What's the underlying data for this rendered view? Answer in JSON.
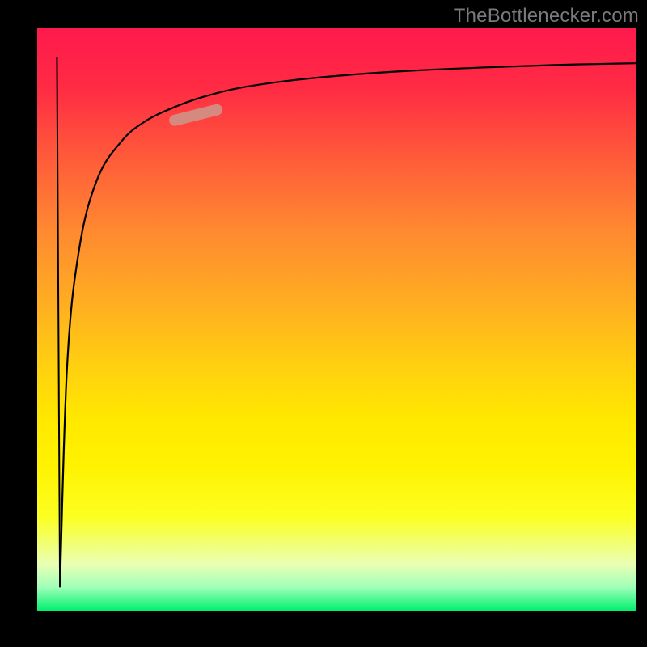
{
  "watermark": "TheBottlenecker.com",
  "chart_data": {
    "type": "line",
    "title": "",
    "xlabel": "",
    "ylabel": "",
    "xlim": [
      0,
      100
    ],
    "ylim": [
      0,
      100
    ],
    "grid": false,
    "legend": false,
    "background": {
      "type": "vertical-gradient",
      "stops": [
        {
          "pos": 0,
          "color": "#ff1a4d"
        },
        {
          "pos": 35,
          "color": "#ff8a30"
        },
        {
          "pos": 67,
          "color": "#ffe800"
        },
        {
          "pos": 92,
          "color": "#eaffb4"
        },
        {
          "pos": 100,
          "color": "#00f070"
        }
      ]
    },
    "series": [
      {
        "name": "left-drop",
        "color": "#000000",
        "width": 2,
        "x": [
          3.3,
          3.8
        ],
        "y": [
          95.0,
          4.0
        ]
      },
      {
        "name": "curve",
        "color": "#000000",
        "width": 2.2,
        "x": [
          3.8,
          5,
          7,
          10,
          14,
          18,
          23,
          28,
          34,
          42,
          52,
          64,
          78,
          90,
          100
        ],
        "y": [
          4.0,
          42,
          62,
          74,
          80.5,
          84,
          86.5,
          88.3,
          89.8,
          91.0,
          92.0,
          92.8,
          93.4,
          93.8,
          94.0
        ]
      }
    ],
    "annotations": [
      {
        "name": "highlight",
        "type": "pill",
        "color": "#d58a80",
        "x": [
          23,
          30
        ],
        "y": [
          84.2,
          86
        ],
        "stroke_width": 14
      }
    ]
  }
}
